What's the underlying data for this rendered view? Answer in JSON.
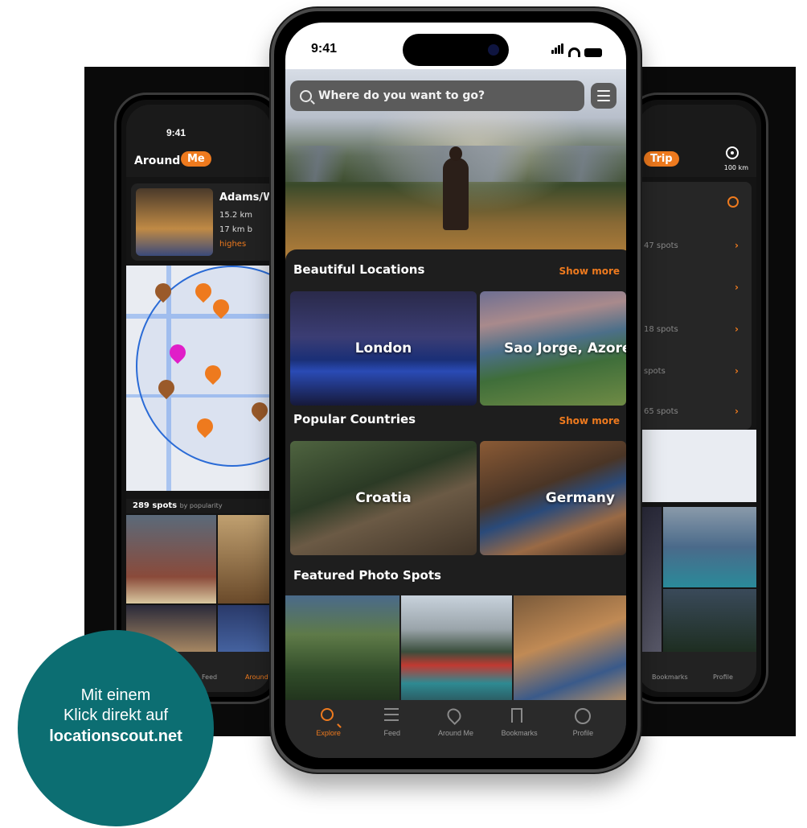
{
  "left_phone": {
    "time": "9:41",
    "title": "Around",
    "pill": "Me",
    "card": {
      "title": "Adams/W",
      "distance": "15.2 km",
      "drive": "17 km b",
      "highlight": "highes"
    },
    "spots_count": "289 spots",
    "spots_sort": "by popularity",
    "tabs": [
      "Feed",
      "Around"
    ]
  },
  "right_phone": {
    "pill": "Trip",
    "radius": "100 km",
    "rows": [
      "47 spots",
      "",
      "18 spots",
      "spots",
      "65 spots"
    ],
    "tabs": [
      "Bookmarks",
      "Profile"
    ]
  },
  "center_phone": {
    "time": "9:41",
    "search_placeholder": "Where do you want to go?",
    "sections": {
      "beautiful": {
        "title": "Beautiful Locations",
        "show_more": "Show more",
        "items": [
          "London",
          "Sao Jorge, Azores"
        ]
      },
      "countries": {
        "title": "Popular Countries",
        "show_more": "Show more",
        "items": [
          "Croatia",
          "Germany"
        ]
      },
      "featured": {
        "title": "Featured Photo Spots"
      }
    },
    "tabs": [
      {
        "label": "Explore",
        "icon": "search-icon",
        "active": true
      },
      {
        "label": "Feed",
        "icon": "feed-icon",
        "active": false
      },
      {
        "label": "Around Me",
        "icon": "location-pin-icon",
        "active": false
      },
      {
        "label": "Bookmarks",
        "icon": "bookmark-icon",
        "active": false
      },
      {
        "label": "Profile",
        "icon": "profile-icon",
        "active": false
      }
    ]
  },
  "badge": {
    "line1": "Mit einem",
    "line2": "Klick direkt auf",
    "link": "locationscout.net"
  },
  "colors": {
    "accent": "#ee7a1e",
    "badge": "#0c6e72",
    "map_circle": "#2a6bd6"
  }
}
